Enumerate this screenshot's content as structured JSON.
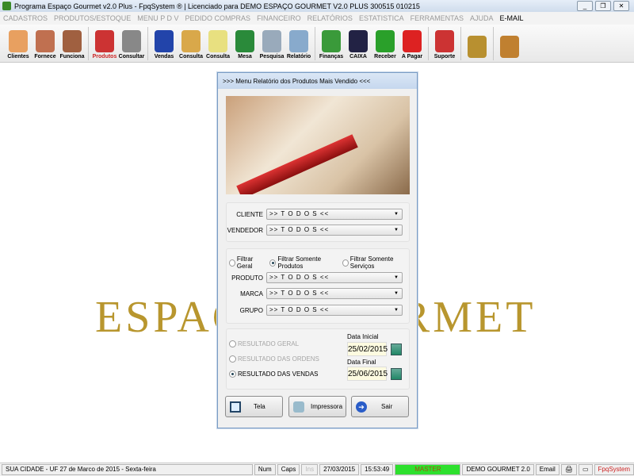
{
  "window": {
    "title": "Programa Espaço Gourmet v2.0 Plus - FpqSystem ® | Licenciado para  DEMO ESPAÇO GOURMET V2.0 PLUS 300515 010215"
  },
  "menu": [
    "CADASTROS",
    "PRODUTOS/ESTOQUE",
    "MENU P D V",
    "PEDIDO COMPRAS",
    "FINANCEIRO",
    "RELATÓRIOS",
    "ESTATISTICA",
    "FERRAMENTAS",
    "AJUDA"
  ],
  "menu_email": "E-MAIL",
  "toolbar": [
    {
      "label": "Clientes",
      "icon": "clients-icon",
      "color": "#e8a060"
    },
    {
      "label": "Fornece",
      "icon": "supplier-icon",
      "color": "#c07050"
    },
    {
      "label": "Funciona",
      "icon": "employee-icon",
      "color": "#a06040"
    },
    {
      "sep": true
    },
    {
      "label": "Produtos",
      "icon": "products-icon",
      "color": "#c33",
      "red": true
    },
    {
      "label": "Consultar",
      "icon": "barcode-icon",
      "color": "#888"
    },
    {
      "sep": true
    },
    {
      "label": "Vendas",
      "icon": "pdv-icon",
      "color": "#2244aa"
    },
    {
      "label": "Consulta",
      "icon": "folder-icon",
      "color": "#d9a84a"
    },
    {
      "label": "Consulta",
      "icon": "receipt-icon",
      "color": "#e8e080"
    },
    {
      "label": "Mesa",
      "icon": "table-icon",
      "color": "#2a8a3a"
    },
    {
      "label": "Pesquisa",
      "icon": "search-doc-icon",
      "color": "#9ab"
    },
    {
      "label": "Relatório",
      "icon": "report-icon",
      "color": "#8ac"
    },
    {
      "sep": true
    },
    {
      "label": "Finanças",
      "icon": "finance-icon",
      "color": "#3a9a3a"
    },
    {
      "label": "CAIXA",
      "icon": "cashbook-icon",
      "color": "#224"
    },
    {
      "label": "Receber",
      "icon": "receive-icon",
      "color": "#2aa02a"
    },
    {
      "label": "A Pagar",
      "icon": "pay-icon",
      "color": "#d22"
    },
    {
      "sep": true
    },
    {
      "label": "Suporte",
      "icon": "support-icon",
      "color": "#c33"
    },
    {
      "sep": true
    },
    {
      "label": "",
      "icon": "coins-icon",
      "color": "#b89030"
    },
    {
      "sep": true
    },
    {
      "label": "",
      "icon": "exit-icon",
      "color": "#c08030"
    }
  ],
  "background_logo": "ESPAÇO GOURMET",
  "dialog": {
    "title": ">>> Menu Relatório dos Produtos Mais Vendido <<<",
    "cliente_label": "CLIENTE",
    "cliente_value": ">> T O D O S <<",
    "vendedor_label": "VENDEDOR",
    "vendedor_value": ">> T O D O S <<",
    "filters": [
      "Filtrar Geral",
      "Filtrar Somente Produtos",
      "Filtrar Somente Serviços"
    ],
    "filter_selected": 1,
    "produto_label": "PRODUTO",
    "produto_value": ">> T O D O S <<",
    "marca_label": "MARCA",
    "marca_value": ">> T O D O S <<",
    "grupo_label": "GRUPO",
    "grupo_value": ">> T O D O S <<",
    "results": [
      "RESULTADO GERAL",
      "RESULTADO DAS ORDENS",
      "RESULTADO DAS VENDAS"
    ],
    "data_inicial_label": "Data Inicial",
    "data_inicial": "25/02/2015",
    "data_final_label": "Data Final",
    "data_final": "25/06/2015",
    "btn_tela": "Tela",
    "btn_impressora": "Impressora",
    "btn_sair": "Sair"
  },
  "status": {
    "location": "SUA CIDADE - UF 27 de Marco de 2015 - Sexta-feira",
    "num": "Num",
    "caps": "Caps",
    "ins": "Ins",
    "date": "27/03/2015",
    "time": "15:53:49",
    "user": "MASTER",
    "company": "DEMO GOURMET 2.0",
    "email": "Email",
    "brand": "FpqSystem"
  }
}
